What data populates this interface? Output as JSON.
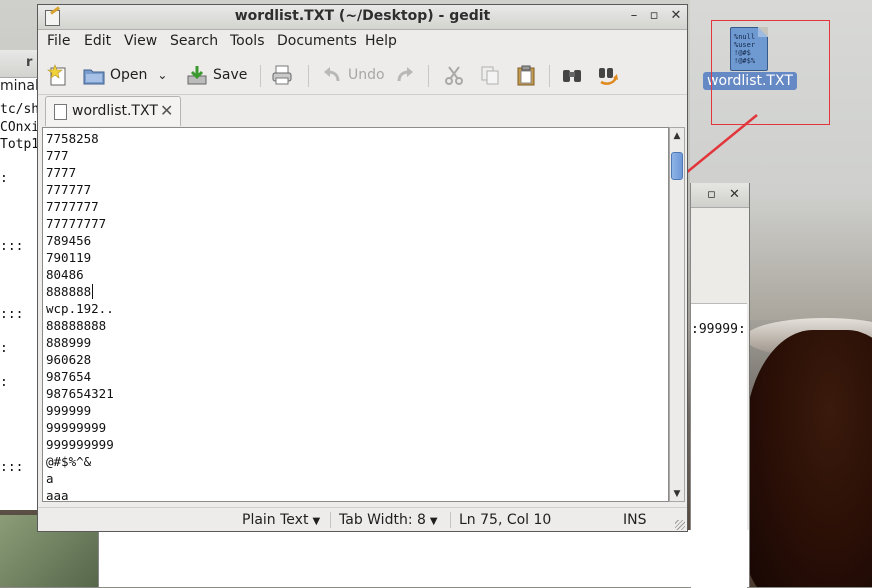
{
  "window": {
    "title": "wordlist.TXT (~/Desktop) - gedit"
  },
  "menu": [
    "File",
    "Edit",
    "View",
    "Search",
    "Tools",
    "Documents",
    "Help"
  ],
  "toolbar": {
    "open": "Open",
    "save": "Save",
    "undo": "Undo"
  },
  "tab": {
    "label": "wordlist.TXT"
  },
  "editor": {
    "lines": [
      "7758258",
      "777",
      "7777",
      "777777",
      "7777777",
      "77777777",
      "789456",
      "790119",
      "80486",
      "888888",
      "wcp.192..",
      "88888888",
      "888999",
      "960628",
      "987654",
      "987654321",
      "999999",
      "99999999",
      "999999999",
      "@#$%^&",
      "a",
      "aaa"
    ],
    "caret_line": 9
  },
  "status": {
    "language": "Plain Text",
    "tab_width": "Tab Width:  8",
    "position": "Ln 75, Col 10",
    "mode": "INS"
  },
  "desktop": {
    "icon_label": "wordlist.TXT",
    "icon_preview": "%null\n%user\n!@#$\n!@#$%"
  },
  "background": {
    "terminal_title_fragment": "r",
    "terminal_menu_fragment": "minal",
    "terminal_lines": [
      "tc/sh",
      "COnxi",
      "Totp1",
      ":",
      ":::",
      ":::",
      ":",
      ":",
      ":::"
    ],
    "window2_text": ":99999:"
  },
  "colors": {
    "annotation": "#e2353c",
    "selection": "#6589c4"
  }
}
